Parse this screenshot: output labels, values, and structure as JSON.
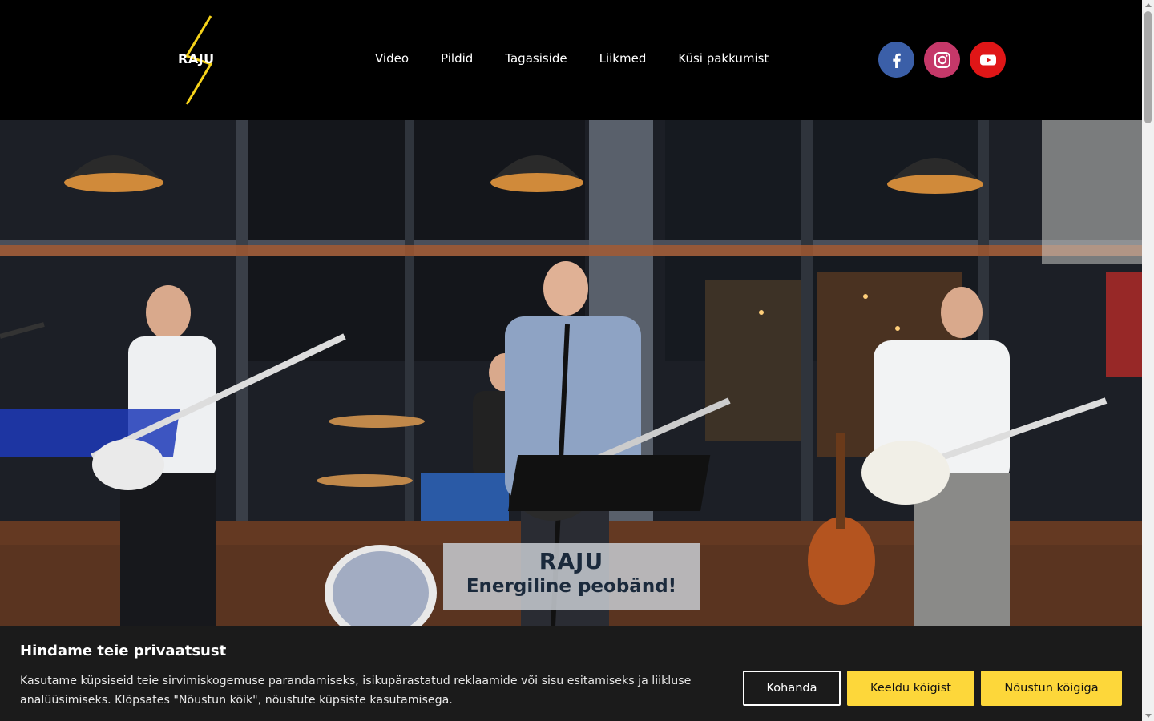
{
  "header": {
    "logo_text": "RAJU",
    "nav": [
      {
        "label": "Video"
      },
      {
        "label": "Pildid"
      },
      {
        "label": "Tagasiside"
      },
      {
        "label": "Liikmed"
      },
      {
        "label": "Küsi pakkumist"
      }
    ],
    "socials": [
      {
        "icon": "facebook-icon",
        "color": "#3b5fa8"
      },
      {
        "icon": "instagram-icon",
        "color": "#c53869"
      },
      {
        "icon": "youtube-icon",
        "color": "#e01617"
      }
    ]
  },
  "hero": {
    "caption_title": "RAJU",
    "caption_subtitle": "Energiline peobänd!"
  },
  "cookie": {
    "title": "Hindame teie privaatsust",
    "text": "Kasutame küpsiseid teie sirvimiskogemuse parandamiseks, isikupärastatud reklaamide või sisu esitamiseks ja liikluse analüüsimiseks. Klõpsates \"Nõustun kõik\", nõustute küpsiste kasutamisega.",
    "customize_label": "Kohanda",
    "reject_label": "Keeldu kõigist",
    "accept_label": "Nõustun kõigiga",
    "accent_color": "#fdd73a"
  }
}
